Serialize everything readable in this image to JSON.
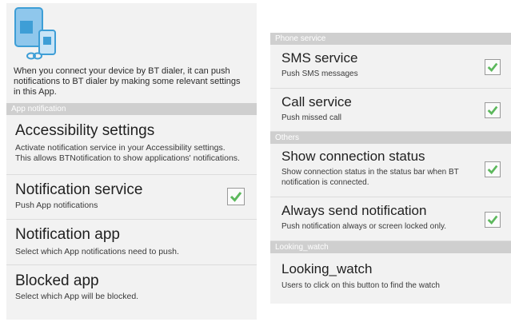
{
  "left": {
    "intro_text": "When you connect your device by BT dialer, it can push notifications to BT dialer by making some relevant settings in this App.",
    "section_app_notification": "App notification",
    "accessibility": {
      "title": "Accessibility settings",
      "summary": "Activate notification service in your Accessibility settings. This allows BTNotification to show applications' notifications."
    },
    "notification_service": {
      "title": "Notification service",
      "summary": "Push App notifications",
      "checked": true
    },
    "notification_app": {
      "title": "Notification app",
      "summary": "Select which App notifications need to push."
    },
    "blocked_app": {
      "title": "Blocked app",
      "summary": "Select which App will be blocked."
    }
  },
  "right": {
    "section_phone_service": "Phone service",
    "sms_service": {
      "title": "SMS service",
      "summary": "Push SMS messages",
      "checked": true
    },
    "call_service": {
      "title": "Call service",
      "summary": "Push missed call",
      "checked": true
    },
    "section_others": "Others",
    "show_connection_status": {
      "title": "Show connection status",
      "summary": "Show connection status in the status bar when BT notification is connected.",
      "checked": true
    },
    "always_send_notification": {
      "title": "Always send notification",
      "summary": "Push notification always or screen locked only.",
      "checked": true
    },
    "section_looking_watch": "Looking_watch",
    "looking_watch": {
      "title": "Looking_watch",
      "summary": "Users to click on this button to find the watch"
    }
  },
  "colors": {
    "accent_blue": "#3e9ed6",
    "check_green": "#5cb85c",
    "section_header_bg": "#cfcfcf"
  },
  "icons": {
    "app_icon": "devices-link-icon",
    "check": "checkmark-icon"
  }
}
